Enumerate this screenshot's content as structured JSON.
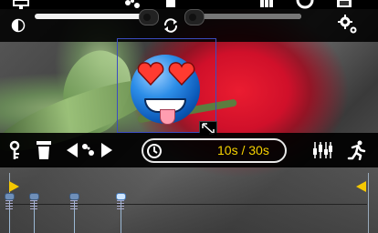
{
  "app": {
    "accent_color": "#f5c800",
    "selection_color": "#3b4cc0"
  },
  "top_toolbar": {
    "icons": [
      "monitor-icon",
      "sticker-icon",
      "trash-icon",
      "layout-icon",
      "film-reel-icon",
      "filmstrip-icon"
    ]
  },
  "adjust_row": {
    "left_slider_value": 0.95,
    "right_slider_value": 0.05,
    "icons": [
      "contrast-icon",
      "rotate-icon",
      "settings-icon"
    ]
  },
  "edit_toolbar": {
    "icons": [
      "key-icon",
      "trash-icon",
      "move-prev-icon",
      "split-icon",
      "move-next-icon",
      "clock-icon",
      "equalizer-icon",
      "run-icon"
    ],
    "time_display": "10s / 30s"
  },
  "timeline": {
    "keyframes": [
      0.0,
      0.07,
      0.18,
      0.31
    ],
    "active_keyframe": 3
  }
}
